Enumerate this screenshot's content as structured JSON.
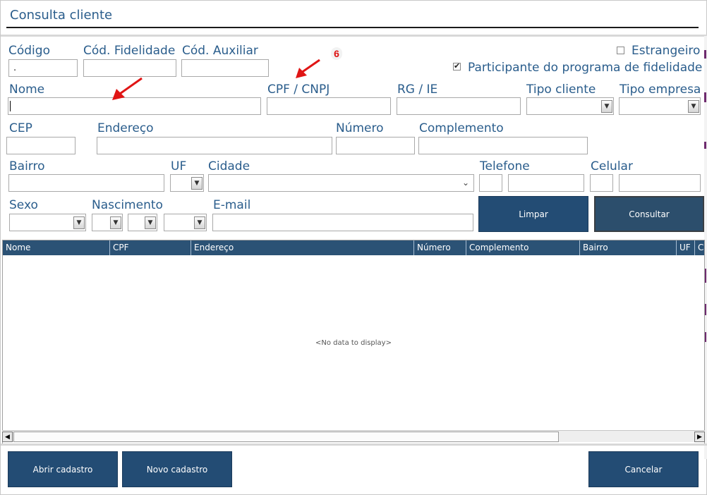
{
  "window": {
    "title": "Consulta cliente"
  },
  "form": {
    "codigo_label": "Código",
    "codigo_value": ".",
    "cod_fidelidade_label": "Cód. Fidelidade",
    "cod_auxiliar_label": "Cód. Auxiliar",
    "estrangeiro_label": "Estrangeiro",
    "estrangeiro_checked": false,
    "participante_label": "Participante do programa de fidelidade",
    "participante_checked": true,
    "nome_label": "Nome",
    "cpf_label": "CPF / CNPJ",
    "rg_label": "RG / IE",
    "tipo_cliente_label": "Tipo cliente",
    "tipo_empresa_label": "Tipo empresa",
    "cep_label": "CEP",
    "endereco_label": "Endereço",
    "numero_label": "Número",
    "complemento_label": "Complemento",
    "bairro_label": "Bairro",
    "uf_label": "UF",
    "cidade_label": "Cidade",
    "telefone_label": "Telefone",
    "celular_label": "Celular",
    "sexo_label": "Sexo",
    "nascimento_label": "Nascimento",
    "email_label": "E-mail"
  },
  "buttons": {
    "limpar": "Limpar",
    "consultar": "Consultar",
    "abrir_cadastro": "Abrir cadastro",
    "novo_cadastro": "Novo cadastro",
    "cancelar": "Cancelar"
  },
  "grid": {
    "columns": [
      "Nome",
      "CPF",
      "Endereço",
      "Número",
      "Complemento",
      "Bairro",
      "UF",
      "Ci"
    ],
    "empty_text": "<No data to display>"
  },
  "annotation": {
    "number": "6",
    "color": "#dd1111"
  },
  "colors": {
    "accent": "#234c74",
    "header": "#2b5275",
    "label": "#2a5d8c"
  }
}
